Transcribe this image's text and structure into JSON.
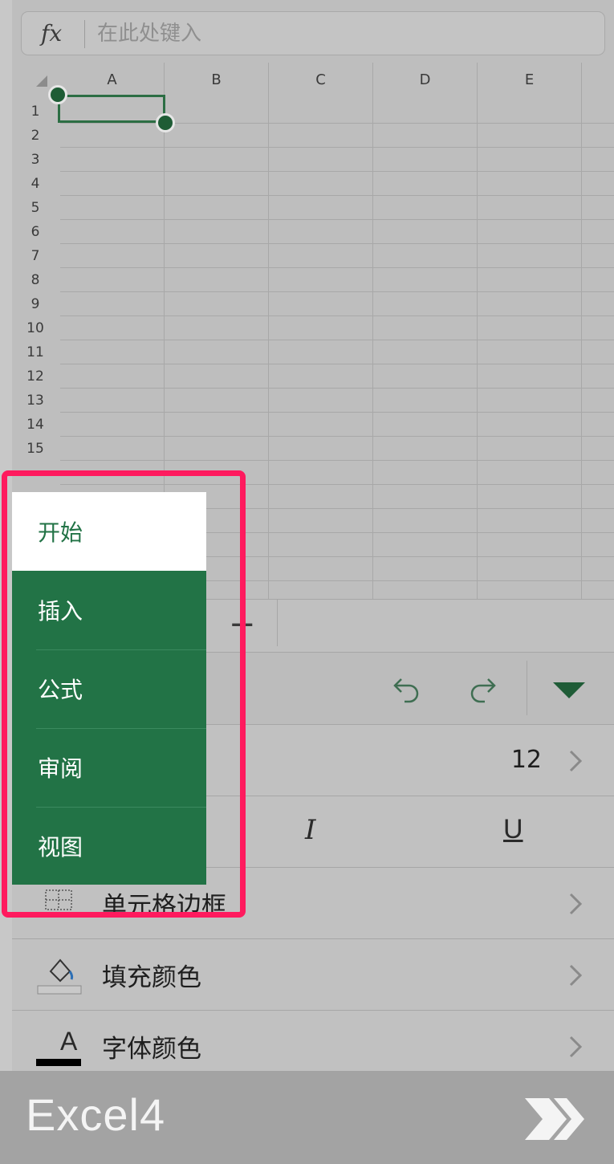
{
  "formula_bar": {
    "fx_label": "fx",
    "placeholder": "在此处键入"
  },
  "columns": [
    "A",
    "B",
    "C",
    "D",
    "E"
  ],
  "rows": [
    "1",
    "2",
    "3",
    "4",
    "5",
    "6",
    "7",
    "8",
    "9",
    "10",
    "11",
    "12",
    "13",
    "14",
    "15"
  ],
  "nav_menu": {
    "items": [
      {
        "label": "开始",
        "active": true
      },
      {
        "label": "插入",
        "active": false
      },
      {
        "label": "公式",
        "active": false
      },
      {
        "label": "审阅",
        "active": false
      },
      {
        "label": "视图",
        "active": false
      }
    ]
  },
  "font_size": {
    "value": "12"
  },
  "format_buttons": {
    "italic": "I",
    "underline": "U"
  },
  "rows_panel": {
    "borders_label": "单元格边框",
    "fill_label": "填充颜色",
    "font_color_label": "字体颜色",
    "font_color_glyph": "A"
  },
  "banner": {
    "text": "Excel4"
  },
  "colors": {
    "accent": "#227346",
    "highlight": "#ff1a5e"
  }
}
